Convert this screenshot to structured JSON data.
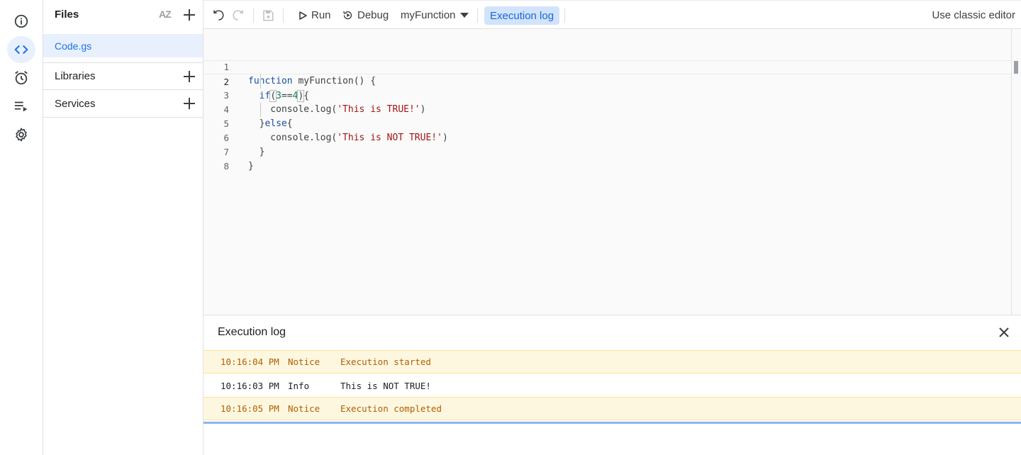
{
  "rail": {
    "items": [
      {
        "icon": "info-icon"
      },
      {
        "icon": "code-icon",
        "active": true
      },
      {
        "icon": "alarm-icon"
      },
      {
        "icon": "executions-icon"
      },
      {
        "icon": "gear-icon"
      }
    ]
  },
  "files": {
    "title": "Files",
    "sort_label": "AZ",
    "items": [
      {
        "name": "Code.gs"
      }
    ],
    "libraries_label": "Libraries",
    "services_label": "Services"
  },
  "toolbar": {
    "run_label": "Run",
    "debug_label": "Debug",
    "function_selected": "myFunction",
    "execution_log_label": "Execution log",
    "classic_label": "Use classic editor"
  },
  "editor": {
    "current_line": 2,
    "lines": [
      {
        "n": "1",
        "text": "function myFunction() {"
      },
      {
        "n": "2",
        "text": "  if(3==4){"
      },
      {
        "n": "3",
        "text": "    console.log('This is TRUE!')"
      },
      {
        "n": "4",
        "text": "  }else{"
      },
      {
        "n": "5",
        "text": "    console.log('This is NOT TRUE!')"
      },
      {
        "n": "6",
        "text": "  }"
      },
      {
        "n": "7",
        "text": "}"
      },
      {
        "n": "8",
        "text": ""
      }
    ]
  },
  "log": {
    "title": "Execution log",
    "rows": [
      {
        "time": "10:16:04 PM",
        "level": "Notice",
        "message": "Execution started"
      },
      {
        "time": "10:16:03 PM",
        "level": "Info",
        "message": "This is NOT TRUE!"
      },
      {
        "time": "10:16:05 PM",
        "level": "Notice",
        "message": "Execution completed"
      }
    ]
  },
  "colors": {
    "accent": "#1a73e8",
    "active_bg": "#e8f0fe",
    "notice_bg": "#fef7e0",
    "notice_text": "#b06000",
    "keyword": "#1a4ea6",
    "string": "#a31515",
    "number": "#098658"
  }
}
